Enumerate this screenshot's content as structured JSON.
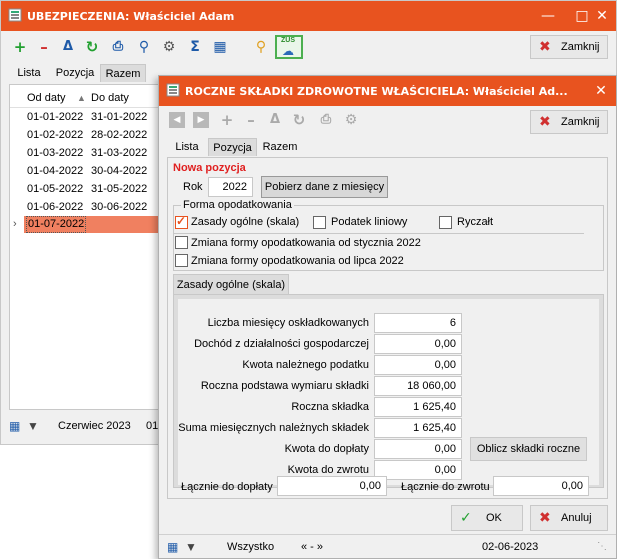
{
  "back_window": {
    "title": "UBEZPIECZENIA: Właściciel Adam",
    "tabs": [
      "Lista",
      "Pozycja",
      "Razem"
    ],
    "columns": {
      "from": "Od daty",
      "to": "Do daty"
    },
    "rows": [
      {
        "from": "01-01-2022",
        "to": "31-01-2022"
      },
      {
        "from": "01-02-2022",
        "to": "28-02-2022"
      },
      {
        "from": "01-03-2022",
        "to": "31-03-2022"
      },
      {
        "from": "01-04-2022",
        "to": "30-04-2022"
      },
      {
        "from": "01-05-2022",
        "to": "31-05-2022"
      },
      {
        "from": "01-06-2022",
        "to": "30-06-2022"
      },
      {
        "from": "01-07-2022",
        "to": ""
      }
    ],
    "close_label": "Zamknij",
    "status_month": "Czerwiec 2023",
    "status_cut": "01",
    "toolbar_badge": "ZUS"
  },
  "front_window": {
    "title": "ROCZNE SKŁADKI ZDROWOTNE WŁAŚCICIELA: Właściciel Ad...",
    "tabs": [
      "Lista",
      "Pozycja",
      "Razem"
    ],
    "close_label": "Zamknij",
    "new_position": "Nowa pozycja",
    "year_label": "Rok",
    "year_value": "2022",
    "fetch_button": "Pobierz dane z miesięcy",
    "tax_form_group": "Forma opodatkowania",
    "options": {
      "general": "Zasady ogólne (skala)",
      "flat": "Podatek liniowy",
      "lump": "Ryczałt",
      "change_jan": "Zmiana formy opodatkowania od stycznia 2022",
      "change_jul": "Zmiana formy opodatkowania od lipca 2022"
    },
    "inner_tab": "Zasady ogólne (skala)",
    "fields": [
      {
        "label": "Liczba miesięcy oskładkowanych",
        "value": "6"
      },
      {
        "label": "Dochód z działalności gospodarczej",
        "value": "0,00"
      },
      {
        "label": "Kwota należnego podatku",
        "value": "0,00"
      },
      {
        "label": "Roczna podstawa wymiaru składki",
        "value": "18 060,00"
      },
      {
        "label": "Roczna składka",
        "value": "1 625,40"
      },
      {
        "label": "Suma miesięcznych należnych składek",
        "value": "1 625,40"
      },
      {
        "label": "Kwota do dopłaty",
        "value": "0,00"
      },
      {
        "label": "Kwota do zwrotu",
        "value": "0,00"
      }
    ],
    "calc_button": "Oblicz składki roczne",
    "total_pay_label": "Łącznie do dopłaty",
    "total_pay_value": "0,00",
    "total_refund_label": "Łącznie do zwrotu",
    "total_refund_value": "0,00",
    "ok_label": "OK",
    "cancel_label": "Anuluj",
    "status_filter": "Wszystko",
    "status_nav": "« - »",
    "status_date": "02-06-2023"
  },
  "colors": {
    "accent": "#e8531f",
    "selected_row": "#f08060",
    "green": "#22a030",
    "red": "#d03030"
  }
}
